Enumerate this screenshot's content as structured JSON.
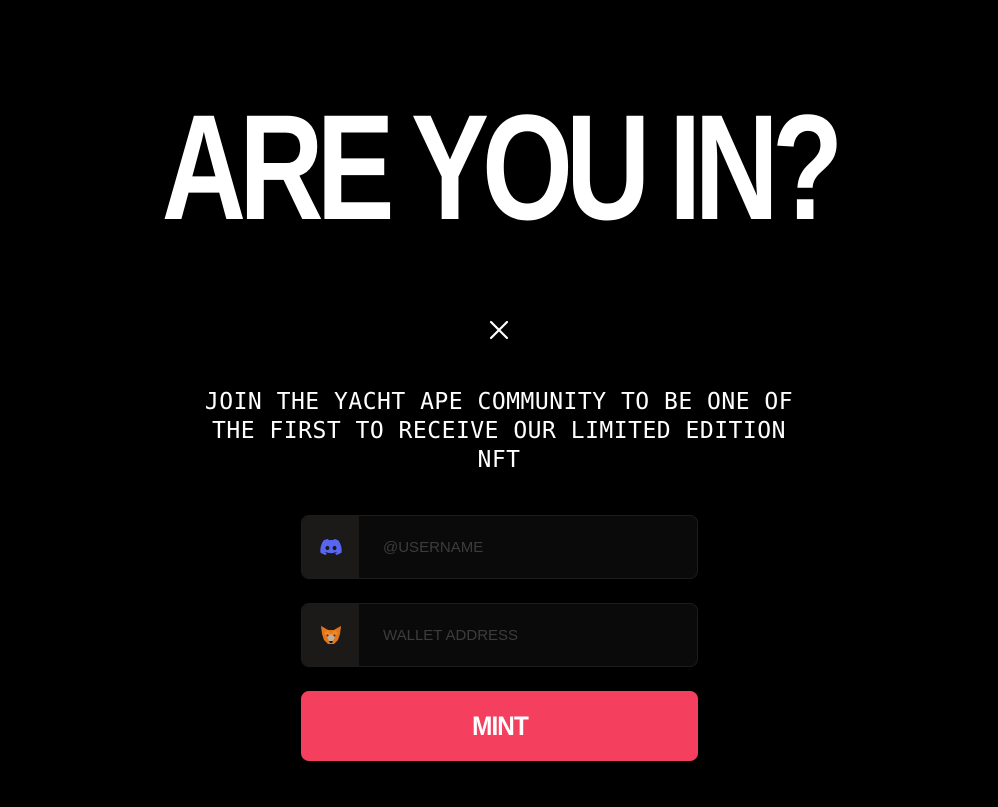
{
  "hero": {
    "headline": "ARE YOU IN?"
  },
  "modal": {
    "close_icon": "close-icon",
    "tagline": "JOIN THE YACHT APE COMMUNITY TO BE ONE OF THE FIRST TO RECEIVE OUR LIMITED EDITION NFT"
  },
  "form": {
    "discord": {
      "icon": "discord-icon",
      "placeholder": "@USERNAME",
      "value": ""
    },
    "wallet": {
      "icon": "metamask-fox-icon",
      "placeholder": "WALLET ADDRESS",
      "value": ""
    },
    "mint_label": "MINT"
  },
  "colors": {
    "background": "#000000",
    "accent": "#f43f5e",
    "discord": "#5865f2",
    "metamask": "#e2761b"
  }
}
